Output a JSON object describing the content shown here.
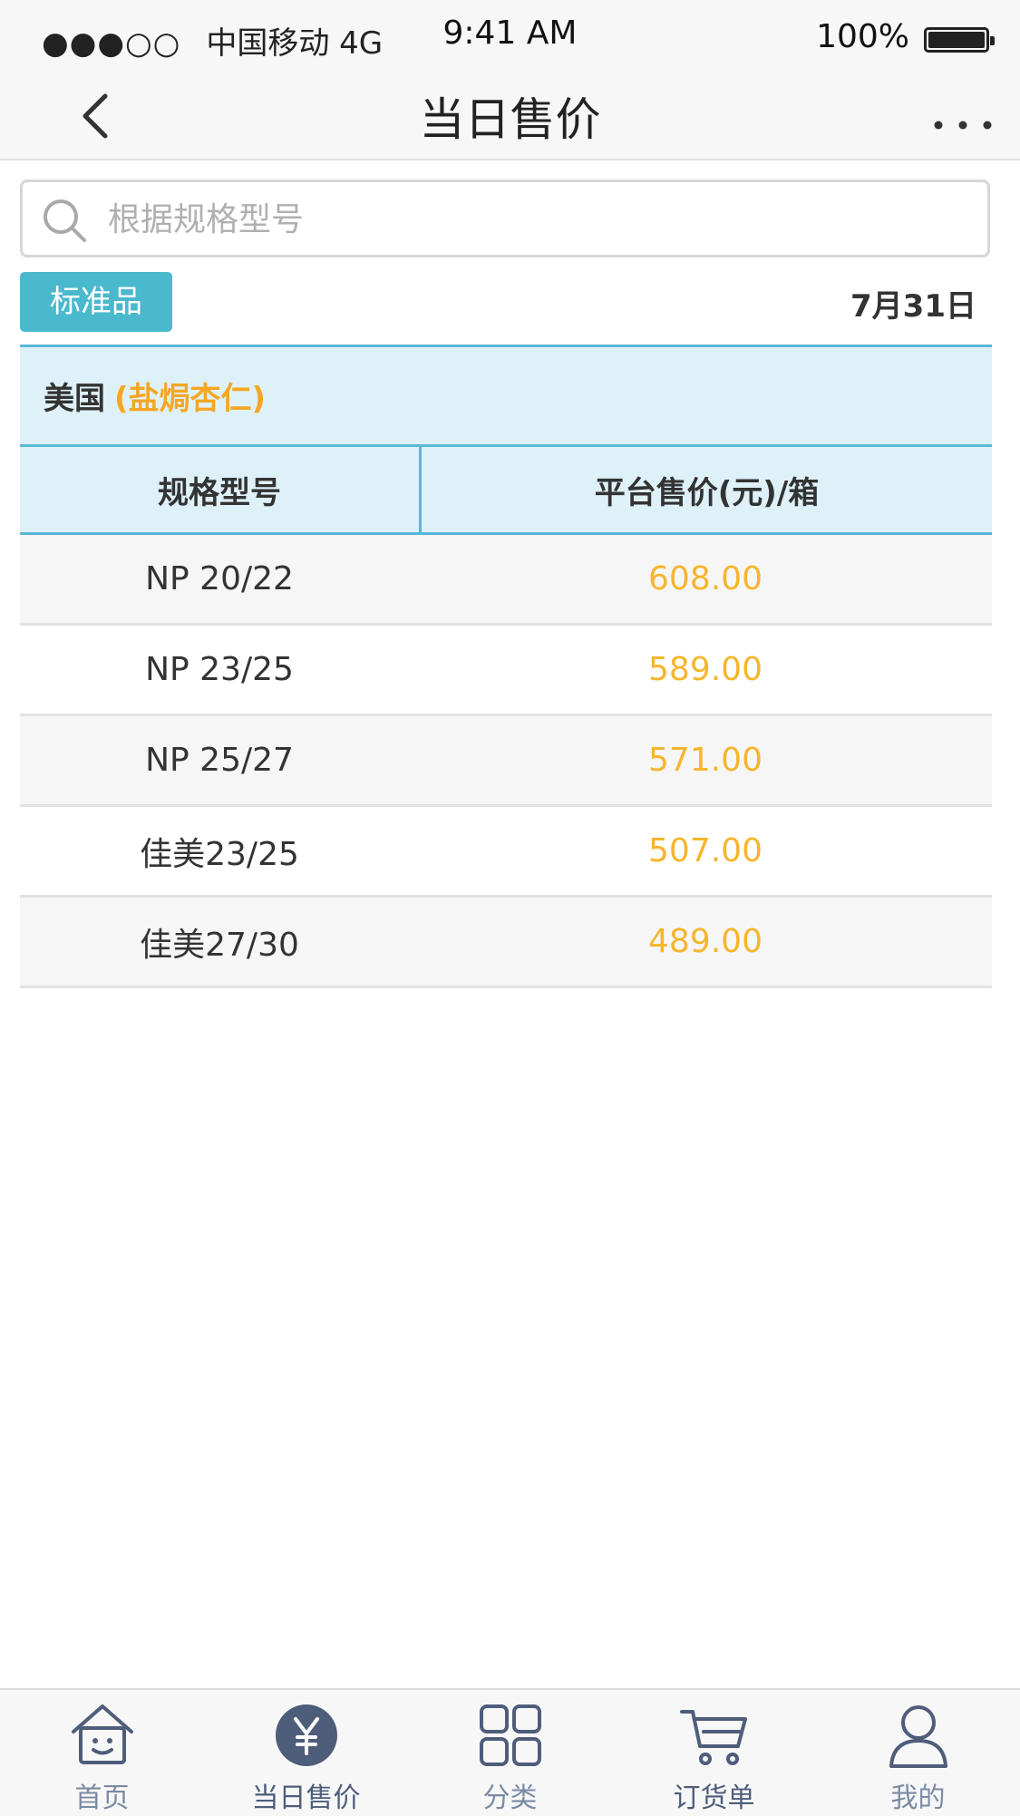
{
  "status_bar": {
    "signal": "●●●○○",
    "carrier": "中国移动 4G",
    "time": "9:41 AM",
    "battery": "100%"
  },
  "nav": {
    "title": "当日售价"
  },
  "search": {
    "placeholder": "根据规格型号"
  },
  "filter": {
    "tag": "标准品",
    "date": "7月31日"
  },
  "table": {
    "group": {
      "origin": "美国",
      "product": "(盐焗杏仁)"
    },
    "columns": [
      "规格型号",
      "平台售价(元)/箱"
    ],
    "rows": [
      {
        "spec": "NP 20/22",
        "price": "608.00"
      },
      {
        "spec": "NP 23/25",
        "price": "589.00"
      },
      {
        "spec": "NP 25/27",
        "price": "571.00"
      },
      {
        "spec": "佳美23/25",
        "price": "507.00"
      },
      {
        "spec": "佳美27/30",
        "price": "489.00"
      }
    ]
  },
  "tabs": [
    {
      "label": "首页",
      "icon": "home-icon"
    },
    {
      "label": "当日售价",
      "icon": "yen-coin-icon"
    },
    {
      "label": "分类",
      "icon": "grid-icon"
    },
    {
      "label": "订货单",
      "icon": "cart-icon"
    },
    {
      "label": "我的",
      "icon": "user-icon"
    }
  ],
  "colors": {
    "accent": "#4ab8cd",
    "price": "#f7b52c",
    "header_bg": "#dff1f8",
    "tab_icon": "#4e5d7a"
  }
}
